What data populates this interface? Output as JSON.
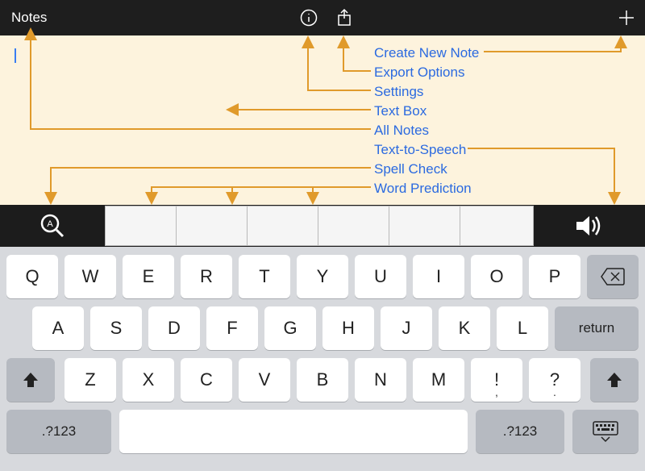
{
  "topbar": {
    "title": "Notes"
  },
  "annotations": {
    "create_new_note": "Create New Note",
    "export_options": "Export Options",
    "settings": "Settings",
    "text_box": "Text Box",
    "all_notes": "All Notes",
    "text_to_speech": "Text-to-Speech",
    "spell_check": "Spell Check",
    "word_prediction": "Word Prediction"
  },
  "keyboard": {
    "row1": [
      "Q",
      "W",
      "E",
      "R",
      "T",
      "Y",
      "U",
      "I",
      "O",
      "P"
    ],
    "row2": [
      "A",
      "S",
      "D",
      "F",
      "G",
      "H",
      "J",
      "K",
      "L"
    ],
    "row3": [
      "Z",
      "X",
      "C",
      "V",
      "B",
      "N",
      "M"
    ],
    "punct1_main": "!",
    "punct1_sub": ",",
    "punct2_main": "?",
    "punct2_sub": ".",
    "return": "return",
    "sym": ".?123"
  },
  "icons": {
    "info": "info-icon",
    "share": "share-icon",
    "plus": "plus-icon",
    "spellcheck": "spellcheck-icon",
    "speaker": "speaker-icon",
    "backspace": "backspace-icon",
    "shift": "shift-icon",
    "dismiss": "dismiss-keyboard-icon"
  },
  "colors": {
    "arrow": "#e09a2b",
    "label": "#2b6ae0"
  }
}
